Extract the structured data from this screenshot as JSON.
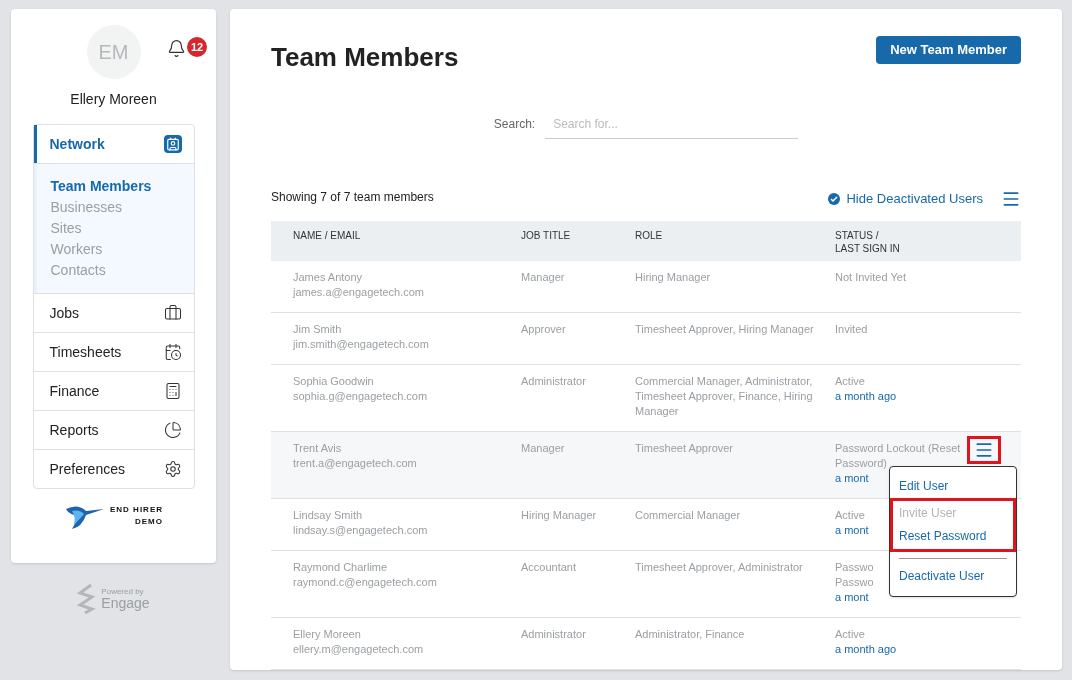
{
  "user": {
    "initials": "EM",
    "name": "Ellery Moreen",
    "notifications": "12"
  },
  "nav": [
    {
      "label": "Network",
      "expanded": true,
      "children": [
        {
          "label": "Team Members",
          "selected": true
        },
        {
          "label": "Businesses",
          "selected": false
        },
        {
          "label": "Sites",
          "selected": false
        },
        {
          "label": "Workers",
          "selected": false
        },
        {
          "label": "Contacts",
          "selected": false
        }
      ]
    },
    {
      "label": "Jobs",
      "expanded": false
    },
    {
      "label": "Timesheets",
      "expanded": false
    },
    {
      "label": "Finance",
      "expanded": false
    },
    {
      "label": "Reports",
      "expanded": false
    },
    {
      "label": "Preferences",
      "expanded": false
    }
  ],
  "logo": {
    "line1": "END HIRER",
    "line2": "DEMO"
  },
  "powered": {
    "small": "Powered by",
    "brand": "Engage"
  },
  "page": {
    "title": "Team Members",
    "new_button": "New Team Member",
    "search_label": "Search:",
    "search_placeholder": "Search for...",
    "showing": "Showing 7 of 7 team members",
    "hide_toggle": {
      "label": "Hide Deactivated Users",
      "checked": true
    }
  },
  "table": {
    "columns": [
      "NAME / EMAIL",
      "JOB TITLE",
      "ROLE",
      "STATUS /\nLAST SIGN IN"
    ],
    "rows": [
      {
        "name": "James Antony",
        "email": "james.a@engagetech.com",
        "job": "Manager",
        "role": "Hiring Manager",
        "status": "Not Invited Yet",
        "selected": false
      },
      {
        "name": "Jim Smith",
        "email": "jim.smith@engagetech.com",
        "job": "Approver",
        "role": "Timesheet Approver, Hiring Manager",
        "status": "Invited",
        "selected": false
      },
      {
        "name": "Sophia Goodwin",
        "email": "sophia.g@engagetech.com",
        "job": "Administrator",
        "role": "Commercial Manager, Administrator, Timesheet Approver, Finance, Hiring Manager",
        "status": "Active",
        "last": "a month ago",
        "selected": false
      },
      {
        "name": "Trent Avis",
        "email": "trent.a@engagetech.com",
        "job": "Manager",
        "role": "Timesheet Approver",
        "status": "Password Lockout (Reset Password)",
        "last": "a mont",
        "selected": true
      },
      {
        "name": "Lindsay Smith",
        "email": "lindsay.s@engagetech.com",
        "job": "Hiring Manager",
        "role": "Commercial Manager",
        "status": "Active",
        "last": "a mont",
        "selected": false
      },
      {
        "name": "Raymond Charlime",
        "email": "raymond.c@engagetech.com",
        "job": "Accountant",
        "role": "Timesheet Approver, Administrator",
        "status": "Passwo\nPasswo",
        "last": "a mont",
        "selected": false
      },
      {
        "name": "Ellery Moreen",
        "email": "ellery.m@engagetech.com",
        "job": "Administrator",
        "role": "Administrator, Finance",
        "status": "Active",
        "last": "a month ago",
        "selected": false
      }
    ]
  },
  "menu": [
    {
      "label": "Edit User",
      "disabled": false,
      "highlighted": false
    },
    {
      "label": "Invite User",
      "disabled": true,
      "highlighted": true
    },
    {
      "label": "Reset Password",
      "disabled": false,
      "highlighted": true
    },
    {
      "label": "Deactivate User",
      "disabled": false,
      "highlighted": false,
      "divider_before": true
    }
  ]
}
